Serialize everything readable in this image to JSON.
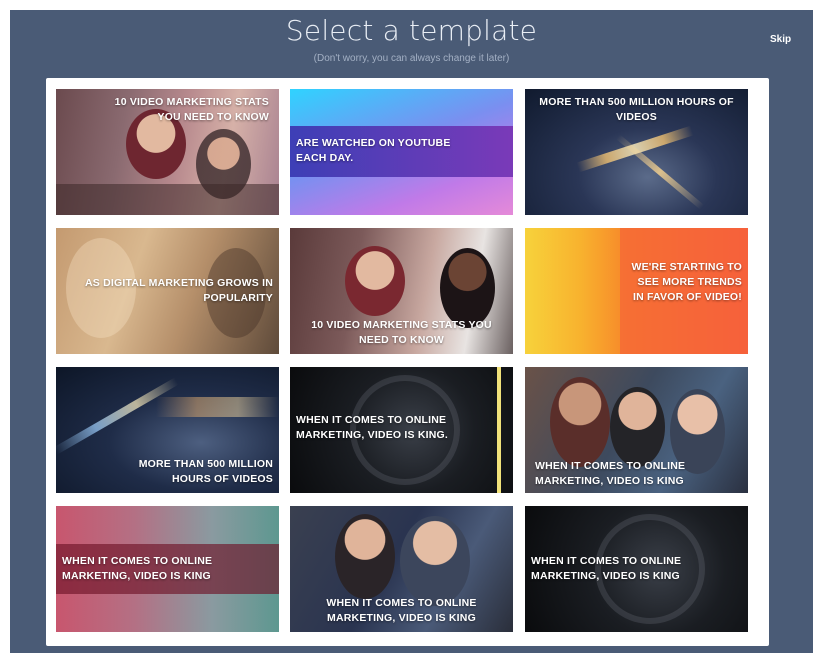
{
  "header": {
    "title": "Select a template",
    "subtitle": "(Don't worry, you can always change it later)",
    "skip_label": "Skip"
  },
  "templates": [
    {
      "caption": "10 VIDEO MARKETING STATS YOU NEED TO KNOW"
    },
    {
      "caption": "ARE WATCHED ON YOUTUBE EACH DAY."
    },
    {
      "caption": "MORE THAN 500 MILLION HOURS OF VIDEOS"
    },
    {
      "caption": "AS DIGITAL MARKETING GROWS IN POPULARITY"
    },
    {
      "caption": "10 VIDEO MARKETING STATS YOU NEED TO KNOW"
    },
    {
      "caption": "WE'RE STARTING TO SEE MORE TRENDS IN FAVOR OF VIDEO!"
    },
    {
      "caption": "MORE THAN 500 MILLION HOURS OF VIDEOS"
    },
    {
      "caption": "WHEN IT COMES TO ONLINE MARKETING, VIDEO IS KING."
    },
    {
      "caption": "WHEN IT COMES TO ONLINE MARKETING, VIDEO IS KING"
    },
    {
      "caption": "WHEN IT COMES TO ONLINE MARKETING, VIDEO IS KING"
    },
    {
      "caption": "WHEN IT COMES TO ONLINE MARKETING, VIDEO IS KING"
    },
    {
      "caption": "WHEN IT COMES TO ONLINE MARKETING, VIDEO IS KING"
    }
  ]
}
